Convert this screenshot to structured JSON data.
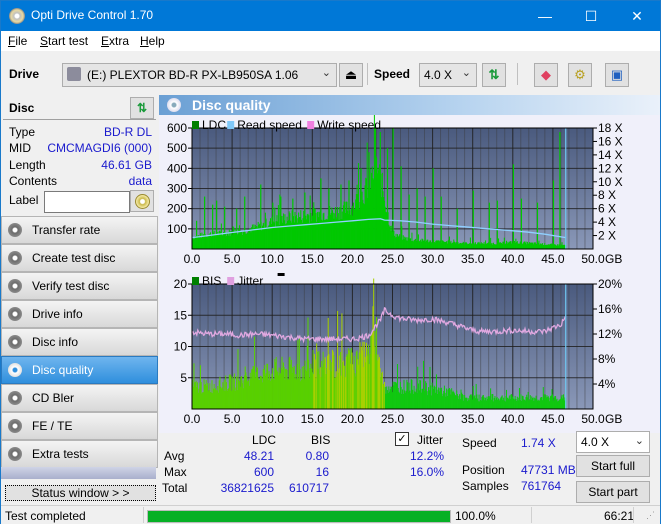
{
  "window": {
    "title": "Opti Drive Control 1.70",
    "controls": {
      "minimize": "—",
      "maximize": "☐",
      "close": "✕"
    }
  },
  "menu": {
    "items": [
      {
        "label": "File",
        "accel": "F",
        "rest": "ile"
      },
      {
        "label": "Start test",
        "accel": "S",
        "rest": "tart test"
      },
      {
        "label": "Extra",
        "accel": "E",
        "rest": "xtra"
      },
      {
        "label": "Help",
        "accel": "H",
        "rest": "elp"
      }
    ]
  },
  "toolbar": {
    "drive_label": "Drive",
    "drive_value": "(E:)  PLEXTOR BD-R  PX-LB950SA 1.06",
    "eject_icon": "⏏",
    "speed_label": "Speed",
    "speed_value": "4.0 X",
    "icons": [
      "refresh-icon",
      "eraser-icon",
      "settings-icon",
      "save-icon"
    ]
  },
  "disc": {
    "title": "Disc",
    "rows": [
      {
        "key": "Type",
        "value": "BD-R DL"
      },
      {
        "key": "MID",
        "value": "CMCMAGDI6 (000)"
      },
      {
        "key": "Length",
        "value": "46.61 GB"
      },
      {
        "key": "Contents",
        "value": "data"
      }
    ],
    "label_key": "Label",
    "label_value": ""
  },
  "nav": {
    "items": [
      {
        "label": "Transfer rate",
        "active": false
      },
      {
        "label": "Create test disc",
        "active": false
      },
      {
        "label": "Verify test disc",
        "active": false
      },
      {
        "label": "Drive info",
        "active": false
      },
      {
        "label": "Disc info",
        "active": false
      },
      {
        "label": "Disc quality",
        "active": true
      },
      {
        "label": "CD Bler",
        "active": false
      },
      {
        "label": "FE / TE",
        "active": false
      },
      {
        "label": "Extra tests",
        "active": false
      }
    ],
    "status_window": "Status window > >"
  },
  "panel": {
    "title": "Disc quality"
  },
  "chart_data": [
    {
      "type": "bar",
      "title": "LDC",
      "legend": [
        {
          "name": "LDC",
          "color": "#008000"
        },
        {
          "name": "Read speed",
          "color": "#80c8f8"
        },
        {
          "name": "Write speed",
          "color": "#f080e0"
        }
      ],
      "legend_position": "top-left",
      "xlabel": "GB",
      "x_ticks": [
        "0.0",
        "5.0",
        "10.0",
        "15.0",
        "20.0",
        "25.0",
        "30.0",
        "35.0",
        "40.0",
        "45.0",
        "50.0"
      ],
      "xlim": [
        0,
        50
      ],
      "y_ticks": [
        "100",
        "200",
        "300",
        "400",
        "500",
        "600"
      ],
      "ylim": [
        0,
        600
      ],
      "y2_ticks": [
        "2 X",
        "4 X",
        "6 X",
        "8 X",
        "10 X",
        "12 X",
        "14 X",
        "16 X",
        "18 X"
      ],
      "y2lim": [
        0,
        18
      ],
      "grid": true,
      "ldc_envelope": {
        "x": [
          0,
          2,
          4,
          6,
          8,
          10,
          12,
          14,
          16,
          18,
          19,
          20,
          21,
          22,
          22.5,
          23,
          23.5,
          24,
          24.5,
          25,
          26,
          27,
          28,
          30,
          32,
          34,
          36,
          38,
          40,
          42,
          44,
          46,
          46.6
        ],
        "y": [
          60,
          75,
          80,
          90,
          110,
          140,
          160,
          170,
          180,
          190,
          200,
          220,
          270,
          320,
          380,
          420,
          350,
          250,
          150,
          80,
          60,
          50,
          45,
          40,
          35,
          30,
          30,
          28,
          35,
          30,
          25,
          20,
          20
        ]
      },
      "ldc_spikes": {
        "x": [
          0.5,
          1.5,
          2.5,
          3,
          4,
          5.5,
          6.5,
          8.5,
          10,
          11,
          12.5,
          14,
          16,
          17,
          18.5,
          19.5,
          21,
          22,
          22.8,
          23.4,
          24.3,
          25,
          26,
          27,
          28,
          29,
          30,
          31,
          33,
          35,
          37,
          38,
          40,
          41,
          43,
          45,
          45.8
        ],
        "y": [
          140,
          260,
          220,
          240,
          210,
          200,
          260,
          320,
          230,
          260,
          250,
          280,
          350,
          300,
          320,
          340,
          400,
          480,
          600,
          580,
          500,
          600,
          410,
          270,
          300,
          260,
          400,
          260,
          200,
          290,
          230,
          240,
          420,
          250,
          230,
          340,
          580
        ]
      },
      "read_speed": {
        "x": [
          0,
          2,
          4,
          6,
          8,
          10,
          12,
          14,
          16,
          18,
          20,
          22,
          23.5,
          24,
          26,
          28,
          30,
          32,
          34,
          36,
          38,
          40,
          42,
          44,
          46.6
        ],
        "y": [
          1.7,
          2.0,
          2.3,
          2.6,
          2.9,
          3.2,
          3.4,
          3.6,
          3.8,
          4.0,
          4.2,
          4.4,
          4.5,
          4.3,
          4.2,
          4.0,
          3.7,
          3.5,
          3.3,
          3.1,
          2.9,
          2.7,
          2.5,
          2.2,
          1.7
        ]
      },
      "end_marker_x": 46.6
    },
    {
      "type": "bar",
      "title": "BIS",
      "legend": [
        {
          "name": "BIS",
          "color": "#008000"
        },
        {
          "name": "Jitter",
          "color": "#e0a0e0"
        }
      ],
      "legend_position": "top-left",
      "xlabel": "GB",
      "x_ticks": [
        "0.0",
        "5.0",
        "10.0",
        "15.0",
        "20.0",
        "25.0",
        "30.0",
        "35.0",
        "40.0",
        "45.0",
        "50.0"
      ],
      "xlim": [
        0,
        50
      ],
      "y_ticks": [
        "5",
        "10",
        "15",
        "20"
      ],
      "ylim": [
        0,
        20
      ],
      "y2_ticks": [
        "4%",
        "8%",
        "12%",
        "16%",
        "20%"
      ],
      "y2lim": [
        0,
        20
      ],
      "grid": true,
      "bis_envelope": {
        "x": [
          0,
          2,
          4,
          6,
          8,
          10,
          12,
          14,
          16,
          18,
          20,
          21,
          22,
          22.5,
          23,
          23.5,
          24,
          26,
          28,
          30,
          32,
          34,
          36,
          38,
          40,
          42,
          44,
          46,
          46.6
        ],
        "y": [
          4,
          4,
          4.5,
          5,
          6,
          7,
          7,
          7,
          8,
          8,
          8.5,
          9,
          10,
          11,
          12,
          6,
          4,
          4,
          4,
          3.5,
          3,
          2,
          2,
          2,
          2,
          2,
          2,
          2,
          2
        ]
      },
      "jitter": {
        "x": [
          0,
          2,
          4,
          6,
          8,
          10,
          12,
          14,
          16,
          18,
          20,
          21,
          22,
          22.5,
          23,
          23.5,
          24,
          25,
          26,
          28,
          30,
          32,
          34,
          35,
          36,
          38,
          40,
          42,
          44,
          45,
          46,
          46.6
        ],
        "y": [
          12.3,
          12.0,
          12.0,
          11.8,
          12.0,
          11.8,
          11.5,
          11.2,
          11.2,
          11.2,
          11.2,
          11.4,
          11.8,
          12.5,
          13.5,
          14.2,
          15.8,
          15.0,
          14.5,
          14.2,
          14.4,
          13.8,
          13.0,
          12.6,
          12.4,
          12.4,
          12.6,
          12.4,
          12.4,
          13.0,
          13.5,
          14.8
        ]
      },
      "end_marker_x": 46.6
    }
  ],
  "stats": {
    "col_ldc": "LDC",
    "col_bis": "BIS",
    "jitter_label": "Jitter",
    "jitter_checked": true,
    "rows": [
      {
        "label": "Avg",
        "ldc": "48.21",
        "bis": "0.80",
        "jitter": "12.2%"
      },
      {
        "label": "Max",
        "ldc": "600",
        "bis": "16",
        "jitter": "16.0%"
      },
      {
        "label": "Total",
        "ldc": "36821625",
        "bis": "610717",
        "jitter": ""
      }
    ],
    "speed_label": "Speed",
    "speed_value": "1.74 X",
    "position_label": "Position",
    "position_value": "47731 MB",
    "samples_label": "Samples",
    "samples_value": "761764",
    "speed_select": "4.0 X",
    "start_full": "Start full",
    "start_part": "Start part"
  },
  "statusbar": {
    "message": "Test completed",
    "progress": 100.0,
    "progress_text": "100.0%",
    "time": "66:21"
  }
}
